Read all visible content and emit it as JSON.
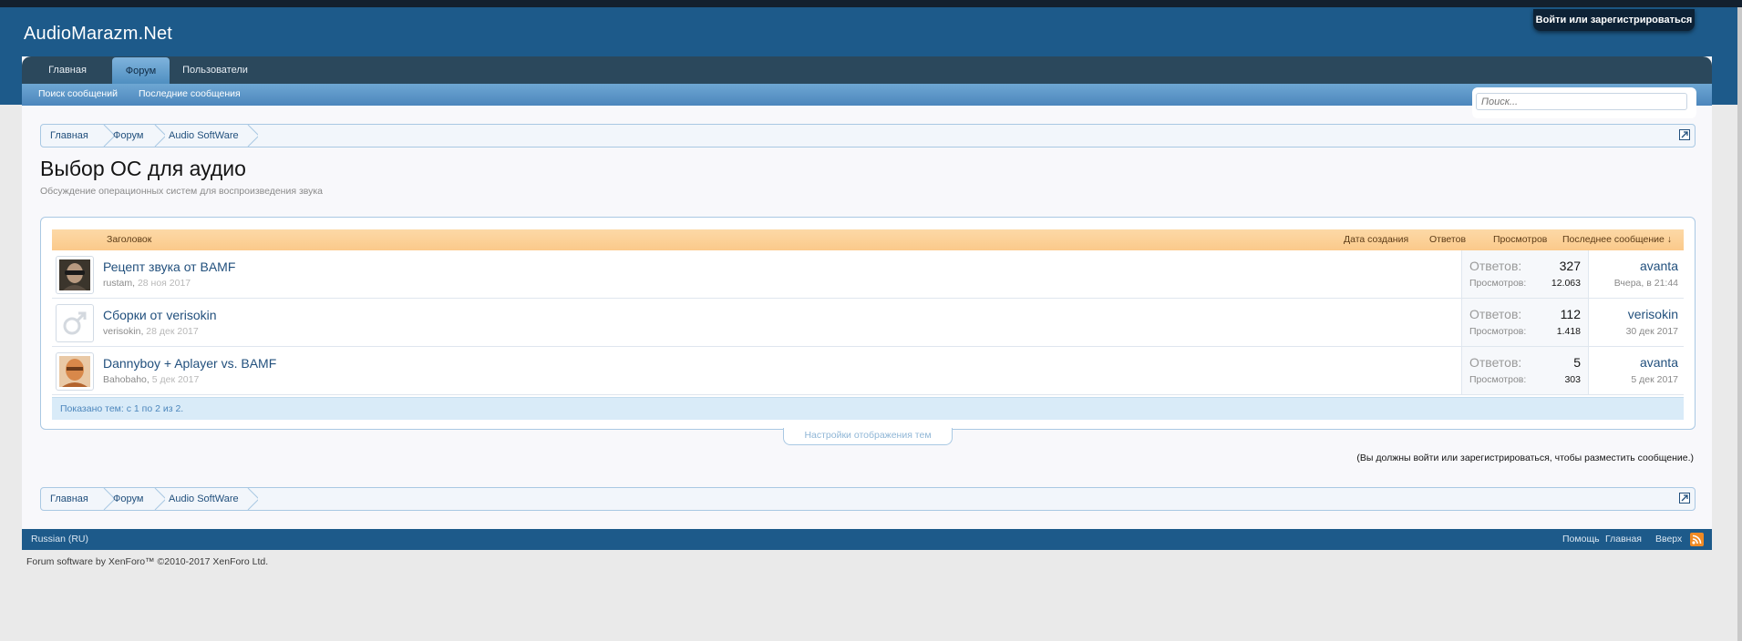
{
  "site": {
    "logo": "AudioMarazm.Net",
    "login_label": "Войти или зарегистрироваться"
  },
  "nav": {
    "tabs": [
      {
        "label": "Главная"
      },
      {
        "label": "Форум"
      },
      {
        "label": "Пользователи"
      }
    ],
    "sublinks": [
      {
        "label": "Поиск сообщений"
      },
      {
        "label": "Последние сообщения"
      }
    ]
  },
  "search": {
    "placeholder": "Поиск..."
  },
  "breadcrumb": [
    {
      "label": "Главная"
    },
    {
      "label": "Форум"
    },
    {
      "label": "Audio SoftWare"
    }
  ],
  "page": {
    "title": "Выбор ОС для аудио",
    "description": "Обсуждение операционных систем для воспроизведения звука"
  },
  "table": {
    "headers": {
      "title": "Заголовок",
      "created": "Дата создания",
      "replies": "Ответов",
      "views": "Просмотров",
      "last": "Последнее сообщение ↓"
    },
    "replies_label": "Ответов:",
    "views_label": "Просмотров:",
    "rows": [
      {
        "title": "Рецепт звука от BAMF",
        "author": "rustam",
        "date": "28 ноя 2017",
        "replies": "327",
        "views": "12.063",
        "last_user": "avanta",
        "last_time": "Вчера, в 21:44",
        "sticky": true
      },
      {
        "title": "Сборки от verisokin",
        "author": "verisokin",
        "date": "28 дек 2017",
        "replies": "112",
        "views": "1.418",
        "last_user": "verisokin",
        "last_time": "30 дек 2017",
        "sticky": false
      },
      {
        "title": "Dannyboy + Aplayer vs. BAMF",
        "author": "Bahobaho",
        "date": "5 дек 2017",
        "replies": "5",
        "views": "303",
        "last_user": "avanta",
        "last_time": "5 дек 2017",
        "sticky": false
      }
    ],
    "footer": "Показано тем: с 1 по 2 из 2."
  },
  "display_settings": "Настройки отображения тем",
  "login_note": "(Вы должны войти или зарегистрироваться, чтобы разместить сообщение.)",
  "footer": {
    "language": "Russian (RU)",
    "links": [
      {
        "label": "Помощь"
      },
      {
        "label": "Главная"
      },
      {
        "label": "Вверх"
      }
    ],
    "copyright": "Forum software by XenForo™ ©2010-2017 XenForo Ltd."
  },
  "icons": {
    "pin": "pin-icon",
    "jump": "jump-to-page-icon",
    "rss": "rss-icon",
    "avatar_default": "male-symbol-avatar"
  },
  "colors": {
    "header": "#1d5a8a",
    "navbar": "#2b485c",
    "link": "#22507d",
    "table_head": "#fbc98a",
    "rss": "#f08a24"
  }
}
